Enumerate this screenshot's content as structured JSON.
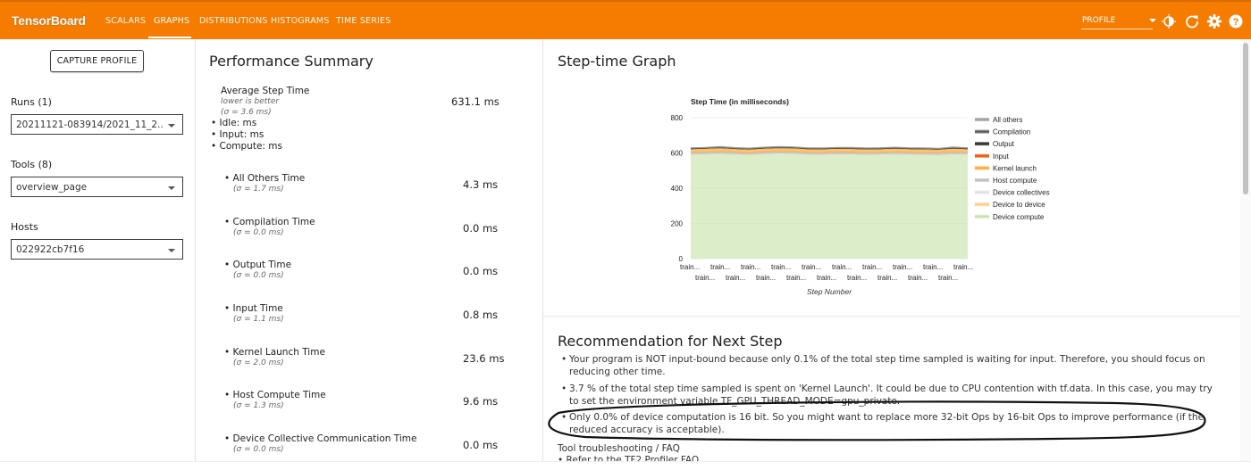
{
  "topbar": {
    "brand": "TensorBoard",
    "tabs": [
      {
        "label": "SCALARS"
      },
      {
        "label": "GRAPHS"
      },
      {
        "label": "DISTRIBUTIONS"
      },
      {
        "label": "HISTOGRAMS"
      },
      {
        "label": "TIME SERIES"
      }
    ],
    "plugin_select": "PROFILE",
    "icons": [
      "theme-toggle-icon",
      "refresh-icon",
      "settings-icon",
      "help-icon"
    ],
    "accent_color": "#f57c00"
  },
  "sidebar": {
    "capture_button": "CAPTURE PROFILE",
    "runs_label": "Runs (1)",
    "runs_value": "20211121-083914/2021_11_2...",
    "tools_label": "Tools (8)",
    "tools_value": "overview_page",
    "hosts_label": "Hosts",
    "hosts_value": "022922cb7f16"
  },
  "performance": {
    "title": "Performance Summary",
    "average": {
      "name": "Average Step Time",
      "note": "lower is better",
      "sigma": "(σ = 3.6 ms)",
      "value": "631.1 ms",
      "idle": "• Idle: ms",
      "input": "• Input: ms",
      "compute": "• Compute: ms"
    },
    "metrics": [
      {
        "name": "• All Others Time",
        "sigma": "(σ = 1.7 ms)",
        "value": "4.3 ms"
      },
      {
        "name": "• Compilation Time",
        "sigma": "(σ = 0.0 ms)",
        "value": "0.0 ms"
      },
      {
        "name": "• Output Time",
        "sigma": "(σ = 0.0 ms)",
        "value": "0.0 ms"
      },
      {
        "name": "• Input Time",
        "sigma": "(σ = 1.1 ms)",
        "value": "0.8 ms"
      },
      {
        "name": "• Kernel Launch Time",
        "sigma": "(σ = 2.0 ms)",
        "value": "23.6 ms"
      },
      {
        "name": "• Host Compute Time",
        "sigma": "(σ = 1.3 ms)",
        "value": "9.6 ms"
      },
      {
        "name": "• Device Collective Communication Time",
        "sigma": "(σ = 0.0 ms)",
        "value": "0.0 ms"
      }
    ]
  },
  "step_graph": {
    "title": "Step-time Graph"
  },
  "chart_data": {
    "type": "area",
    "title": "Step Time (in milliseconds)",
    "xlabel": "Step Number",
    "ylabel": "",
    "ylim": [
      0,
      800
    ],
    "yticks": [
      0,
      200,
      400,
      600,
      800
    ],
    "x_labels_row1": [
      "train...",
      "train...",
      "train...",
      "train...",
      "train...",
      "train...",
      "train...",
      "train...",
      "train...",
      "train..."
    ],
    "x_labels_row2": [
      "train...",
      "train...",
      "train...",
      "train...",
      "train...",
      "train...",
      "train...",
      "train...",
      "train..."
    ],
    "legend": "right",
    "series": [
      {
        "name": "All others",
        "color": "#9e9e9e",
        "values": [
          4,
          4,
          5,
          4,
          4,
          4,
          5,
          4,
          4,
          4,
          4,
          5,
          4,
          4,
          4,
          4,
          4,
          4,
          5,
          4
        ]
      },
      {
        "name": "Compilation",
        "color": "#555555",
        "values": [
          0,
          0,
          0,
          0,
          0,
          0,
          0,
          0,
          0,
          0,
          0,
          0,
          0,
          0,
          0,
          0,
          0,
          0,
          0,
          0
        ]
      },
      {
        "name": "Output",
        "color": "#222222",
        "values": [
          0,
          0,
          0,
          0,
          0,
          0,
          0,
          0,
          0,
          0,
          0,
          0,
          0,
          0,
          0,
          0,
          0,
          0,
          0,
          0
        ]
      },
      {
        "name": "Input",
        "color": "#e65100",
        "values": [
          1,
          1,
          1,
          1,
          1,
          1,
          1,
          1,
          1,
          1,
          1,
          1,
          1,
          1,
          1,
          1,
          1,
          1,
          1,
          1
        ]
      },
      {
        "name": "Kernel launch",
        "color": "#ffa726",
        "values": [
          23,
          24,
          24,
          23,
          24,
          23,
          24,
          24,
          23,
          24,
          23,
          24,
          24,
          23,
          24,
          23,
          24,
          23,
          24,
          24
        ]
      },
      {
        "name": "Host compute",
        "color": "#bdbdbd",
        "values": [
          10,
          9,
          10,
          10,
          9,
          10,
          9,
          10,
          10,
          9,
          10,
          9,
          10,
          10,
          9,
          10,
          9,
          10,
          10,
          9
        ]
      },
      {
        "name": "Device collectives",
        "color": "#e0e0e0",
        "values": [
          0,
          0,
          0,
          0,
          0,
          0,
          0,
          0,
          0,
          0,
          0,
          0,
          0,
          0,
          0,
          0,
          0,
          0,
          0,
          0
        ]
      },
      {
        "name": "Device to device",
        "color": "#ffcc80",
        "values": [
          0,
          0,
          0,
          0,
          0,
          0,
          0,
          0,
          0,
          0,
          0,
          0,
          0,
          0,
          0,
          0,
          0,
          0,
          0,
          0
        ]
      },
      {
        "name": "Device compute",
        "color": "#c5e1a5",
        "values": [
          592,
          594,
          597,
          593,
          590,
          595,
          598,
          596,
          592,
          591,
          594,
          593,
          590,
          592,
          595,
          592,
          591,
          589,
          594,
          592
        ]
      }
    ]
  },
  "recommendation": {
    "title": "Recommendation for Next Step",
    "items": [
      "Your program is NOT input-bound because only 0.1% of the total step time sampled is waiting for input. Therefore, you should focus on reducing other time.",
      "3.7 % of the total step time sampled is spent on 'Kernel Launch'. It could be due to CPU contention with tf.data. In this case, you may try to set the environment variable TF_GPU_THREAD_MODE=gpu_private.",
      "Only 0.0% of device computation is 16 bit. So you might want to replace more 32-bit Ops by 16-bit Ops to improve performance (if the reduced accuracy is acceptable)."
    ],
    "faq_title": "Tool troubleshooting / FAQ",
    "faq_item": "• Refer to the TF2 Profiler FAQ"
  }
}
